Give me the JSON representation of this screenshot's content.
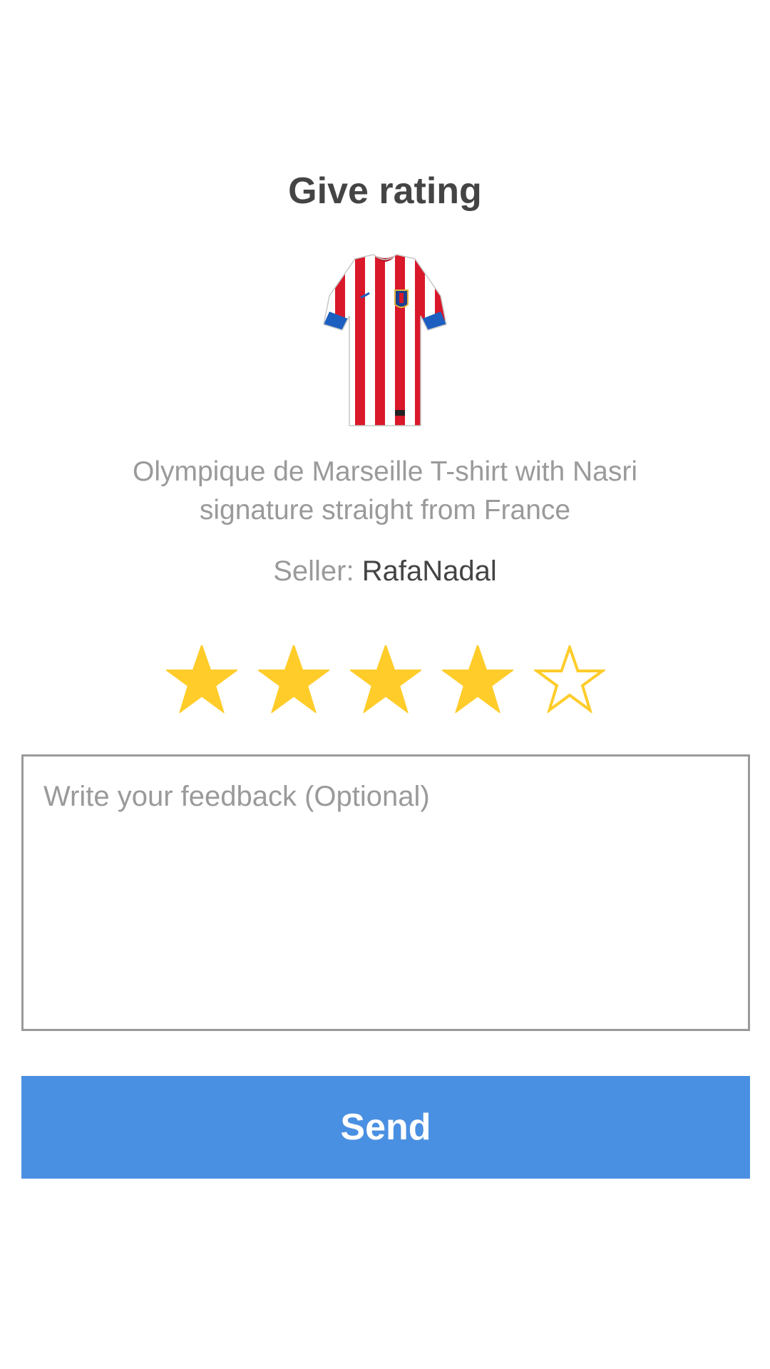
{
  "header": {
    "title": "Give rating"
  },
  "product": {
    "image_icon": "striped-football-jersey",
    "description": "Olympique de Marseille T-shirt with Nasri signature straight from France",
    "seller_label": "Seller:",
    "seller_name": "RafaNadal"
  },
  "rating": {
    "value": 4,
    "max": 5,
    "star_color": "#ffcc2a"
  },
  "feedback": {
    "placeholder": "Write your feedback (Optional)",
    "value": ""
  },
  "actions": {
    "send_label": "Send",
    "send_color": "#4a90e2"
  }
}
